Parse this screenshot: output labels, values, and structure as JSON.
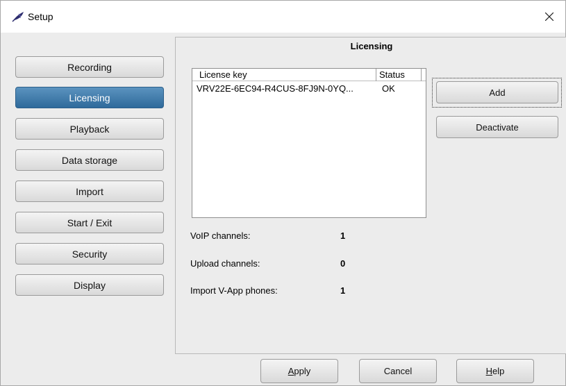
{
  "window": {
    "title": "Setup",
    "app_icon": "feather-quill-icon",
    "close_icon": "close-icon"
  },
  "sidebar": {
    "items": [
      {
        "label": "Recording",
        "active": false
      },
      {
        "label": "Licensing",
        "active": true
      },
      {
        "label": "Playback",
        "active": false
      },
      {
        "label": "Data storage",
        "active": false
      },
      {
        "label": "Import",
        "active": false
      },
      {
        "label": "Start / Exit",
        "active": false
      },
      {
        "label": "Security",
        "active": false
      },
      {
        "label": "Display",
        "active": false
      }
    ]
  },
  "panel": {
    "title": "Licensing",
    "table": {
      "columns": [
        "License key",
        "Status"
      ],
      "rows": [
        {
          "key": "VRV22E-6EC94-R4CUS-8FJ9N-0YQ...",
          "status": "OK"
        }
      ]
    },
    "actions": {
      "add_label": "Add",
      "deactivate_label": "Deactivate"
    },
    "info": [
      {
        "label": "VoIP channels:",
        "value": "1"
      },
      {
        "label": "Upload channels:",
        "value": "0"
      },
      {
        "label": "Import V-App phones:",
        "value": "1"
      }
    ]
  },
  "footer": {
    "apply": {
      "hotkey": "A",
      "rest": "pply"
    },
    "cancel_label": "Cancel",
    "help": {
      "hotkey": "H",
      "rest": "elp"
    }
  },
  "colors": {
    "active_nav": "#3a76a6",
    "window_bg": "#ececec"
  }
}
